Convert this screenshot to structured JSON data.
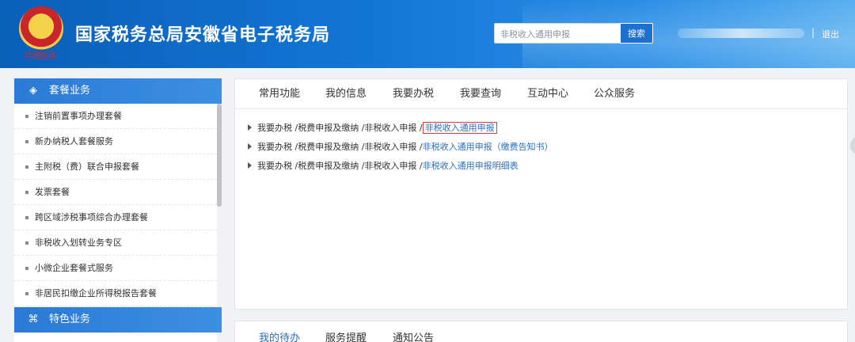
{
  "header": {
    "title": "国家税务总局安徽省电子税务局",
    "brand_script": "中国税务",
    "search": {
      "placeholder": "非税收入通用申报",
      "button": "搜索"
    },
    "separator": "|",
    "logout": "退出"
  },
  "sidebar": {
    "sections": [
      {
        "title": "套餐业务",
        "icon": "layers-icon"
      },
      {
        "title": "特色业务",
        "icon": "command-icon"
      }
    ],
    "items": [
      "注销前置事项办理套餐",
      "新办纳税人套餐服务",
      "主附税（费）联合申报套餐",
      "发票套餐",
      "跨区域涉税事项综合办理套餐",
      "非税收入划转业务专区",
      "小微企业套餐式服务",
      "非居民扣缴企业所得税报告套餐"
    ]
  },
  "main": {
    "tabs": [
      "常用功能",
      "我的信息",
      "我要办税",
      "我要查询",
      "互动中心",
      "公众服务"
    ],
    "rows": [
      {
        "path": "我要办税 /税费申报及缴纳 /非税收入申报 /",
        "link": "非税收入通用申报",
        "highlighted": true
      },
      {
        "path": "我要办税 /税费申报及缴纳 /非税收入申报 /",
        "link": "非税收入通用申报（缴费告知书）",
        "highlighted": false
      },
      {
        "path": "我要办税 /税费申报及缴纳 /非税收入申报 /",
        "link": "非税收入通用申报明细表",
        "highlighted": false
      }
    ],
    "bottom_tabs": [
      "我的待办",
      "服务提醒",
      "通知公告"
    ]
  },
  "colors": {
    "header_blue": "#1377d6",
    "link_blue": "#2a6fbf",
    "highlight_red": "#e03a3a"
  }
}
